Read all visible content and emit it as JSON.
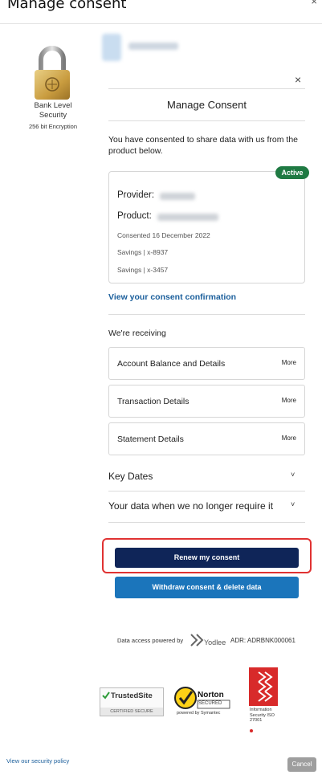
{
  "header": {
    "title": "Manage consent",
    "close_glyph": "×"
  },
  "security": {
    "title": "Bank Level Security",
    "subtitle": "256 bit Encryption",
    "icon": "padlock-icon"
  },
  "panel": {
    "close_glyph": "×",
    "title": "Manage Consent",
    "intro": "You have consented to share data with us from the product below."
  },
  "product_card": {
    "status": "Active",
    "provider_label": "Provider:",
    "product_label": "Product:",
    "consented": "Consented 16 December 2022",
    "accounts": [
      "Savings | x-8937",
      "Savings | x-3457"
    ]
  },
  "consent_link": "View your consent confirmation",
  "receiving": {
    "title": "We're receiving",
    "items": [
      {
        "label": "Account Balance and Details",
        "more": "More"
      },
      {
        "label": "Transaction Details",
        "more": "More"
      },
      {
        "label": "Statement Details",
        "more": "More"
      }
    ]
  },
  "accordions": [
    {
      "title": "Key Dates",
      "chevron": "˅"
    },
    {
      "title": "Your data when we no longer require it",
      "chevron": "˅"
    }
  ],
  "buttons": {
    "renew": "Renew my consent",
    "withdraw": "Withdraw consent & delete data"
  },
  "powered_by": {
    "text": "Data access powered by",
    "brand": "Yodlee",
    "adr": "ADR: ADRBNK000061"
  },
  "badges": {
    "trusted_site": "TrustedSite",
    "trusted_site_sub": "CERTIFIED SECURE",
    "norton": "Norton",
    "norton_sub": "SECURED",
    "norton_by": "powered by Symantec",
    "iso": "Information Security ISO 27001"
  },
  "footer": {
    "security_policy": "View our security policy",
    "cancel": "Cancel"
  },
  "colors": {
    "primary_dark": "#0f2558",
    "primary_blue": "#1b75bb",
    "active_green": "#1f7a43",
    "link_blue": "#1a5e9b",
    "highlight_red": "#e03232"
  }
}
